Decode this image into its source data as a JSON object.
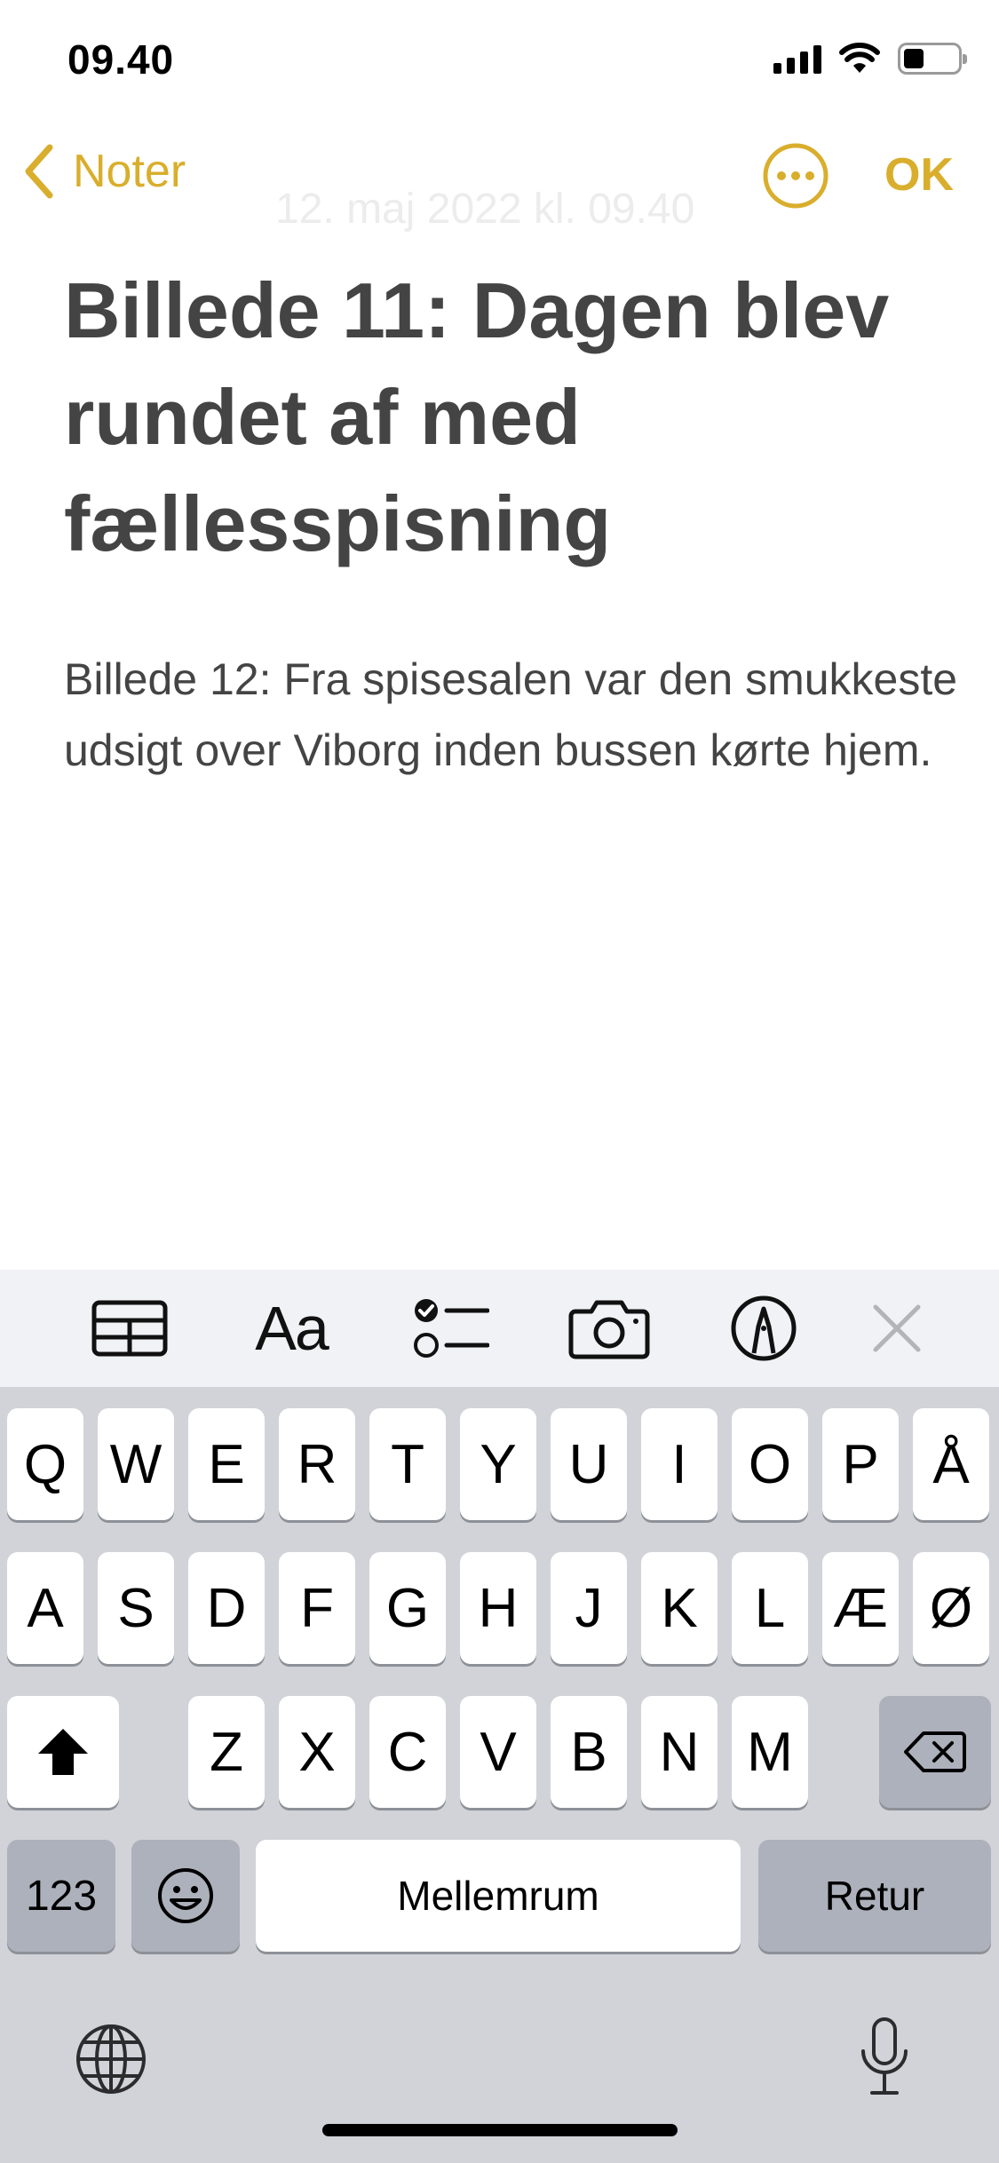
{
  "status_bar": {
    "time": "09.40"
  },
  "nav": {
    "back_label": "Noter",
    "date_text": "12. maj 2022 kl. 09.40",
    "done_label": "OK"
  },
  "note": {
    "title": "Billede 11: Dagen blev rundet af med fællesspisning",
    "body": "Billede 12: Fra spisesalen var den smukkeste udsigt over Viborg inden bussen kørte hjem."
  },
  "toolbar": {
    "text_format_label": "Aa",
    "icons": [
      "table-icon",
      "text-format-icon",
      "checklist-icon",
      "camera-icon",
      "markup-icon",
      "close-icon"
    ]
  },
  "keyboard": {
    "row1": [
      "Q",
      "W",
      "E",
      "R",
      "T",
      "Y",
      "U",
      "I",
      "O",
      "P",
      "Å"
    ],
    "row2": [
      "A",
      "S",
      "D",
      "F",
      "G",
      "H",
      "J",
      "K",
      "L",
      "Æ",
      "Ø"
    ],
    "row3": [
      "Z",
      "X",
      "C",
      "V",
      "B",
      "N",
      "M"
    ],
    "numbers_label": "123",
    "space_label": "Mellemrum",
    "return_label": "Retur"
  },
  "colors": {
    "accent": "#d9ae2c",
    "keyboard_bg": "#d1d3d9",
    "toolbar_bg": "#f1f2f6",
    "dark_key": "#adb1bb"
  }
}
